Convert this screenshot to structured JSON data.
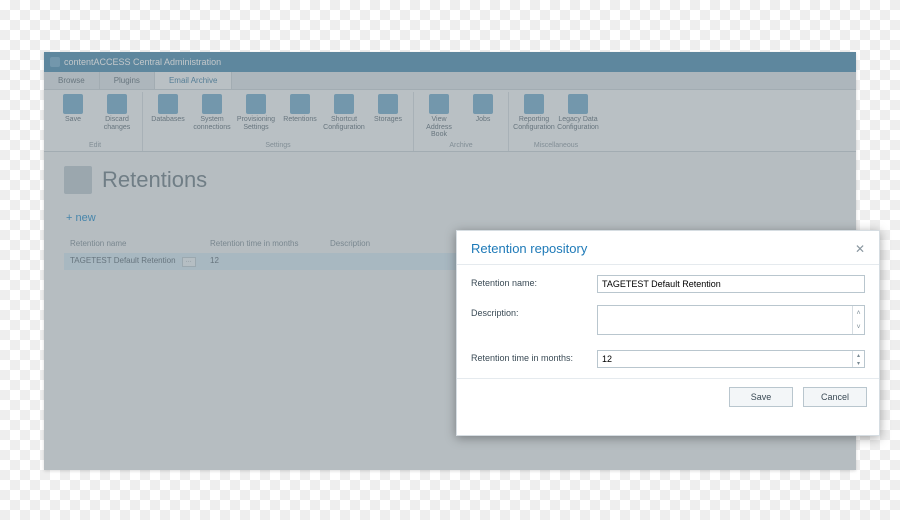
{
  "app_title": "contentACCESS Central Administration",
  "tabs": [
    "Browse",
    "Plugins",
    "Email Archive"
  ],
  "active_tab": 2,
  "ribbon": [
    {
      "label": "Edit",
      "items": [
        "Save",
        "Discard changes"
      ]
    },
    {
      "label": "Settings",
      "items": [
        "Databases",
        "System connections",
        "Provisioning Settings",
        "Retentions",
        "Shortcut Configuration",
        "Storages"
      ]
    },
    {
      "label": "Archive",
      "items": [
        "View Address Book",
        "Jobs"
      ]
    },
    {
      "label": "Miscellaneous",
      "items": [
        "Reporting Configuration",
        "Legacy Data Configuration"
      ]
    }
  ],
  "page_title": "Retentions",
  "new_link": "+  new",
  "grid": {
    "headers": [
      "Retention name",
      "Retention time in months",
      "Description"
    ],
    "rows": [
      {
        "name": "TAGETEST Default Retention",
        "time": "12",
        "desc": ""
      }
    ]
  },
  "dialog": {
    "title": "Retention repository",
    "fields": {
      "name_label": "Retention name:",
      "name_value": "TAGETEST Default Retention",
      "desc_label": "Description:",
      "desc_value": "",
      "time_label": "Retention time in months:",
      "time_value": "12"
    },
    "save": "Save",
    "cancel": "Cancel"
  }
}
